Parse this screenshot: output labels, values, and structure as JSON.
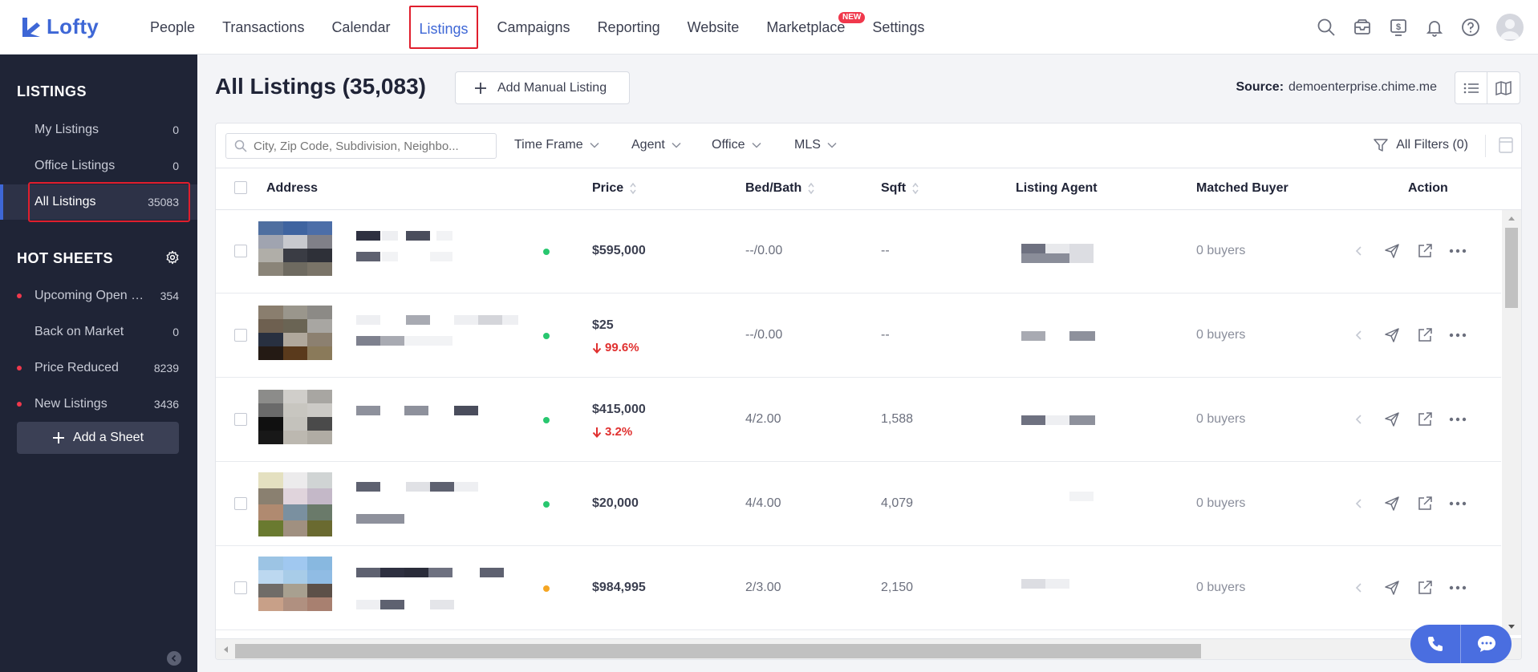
{
  "brand": {
    "name": "Lofty",
    "color": "#3e67d6"
  },
  "nav": {
    "items": [
      "People",
      "Transactions",
      "Calendar",
      "Listings",
      "Campaigns",
      "Reporting",
      "Website",
      "Marketplace",
      "Settings"
    ],
    "active": "Listings",
    "marketplace_badge": "NEW"
  },
  "top_icons": [
    "search-icon",
    "inbox-icon",
    "dollar-icon",
    "bell-icon",
    "help-icon",
    "avatar"
  ],
  "sidebar": {
    "listings_title": "LISTINGS",
    "listings": [
      {
        "label": "My Listings",
        "count": "0"
      },
      {
        "label": "Office Listings",
        "count": "0"
      },
      {
        "label": "All Listings",
        "count": "35083"
      }
    ],
    "hot_sheets_title": "HOT SHEETS",
    "hot_sheets": [
      {
        "label": "Upcoming Open Houses",
        "count": "354",
        "dot": true
      },
      {
        "label": "Back on Market",
        "count": "0",
        "dot": false
      },
      {
        "label": "Price Reduced",
        "count": "8239",
        "dot": true
      },
      {
        "label": "New Listings",
        "count": "3436",
        "dot": true
      }
    ],
    "add_sheet": "Add a Sheet"
  },
  "main": {
    "title": "All Listings (35,083)",
    "add_manual": "Add Manual Listing",
    "source_label": "Source:",
    "source_value": "demoenterprise.chime.me"
  },
  "filters": {
    "search_placeholder": "City, Zip Code, Subdivision, Neighbo...",
    "time_frame": "Time Frame",
    "agent": "Agent",
    "office": "Office",
    "mls": "MLS",
    "all_filters": "All Filters (0)"
  },
  "table": {
    "headers": {
      "address": "Address",
      "price": "Price",
      "bedbath": "Bed/Bath",
      "sqft": "Sqft",
      "agent": "Listing Agent",
      "buyer": "Matched Buyer",
      "action": "Action"
    },
    "rows": [
      {
        "price": "$595,000",
        "change": "",
        "bedbath": "--/0.00",
        "sqft": "--",
        "buyers": "0 buyers",
        "status_color": "#28c76f"
      },
      {
        "price": "$25",
        "change": "99.6%",
        "bedbath": "--/0.00",
        "sqft": "--",
        "buyers": "0 buyers",
        "status_color": "#28c76f"
      },
      {
        "price": "$415,000",
        "change": "3.2%",
        "bedbath": "4/2.00",
        "sqft": "1,588",
        "buyers": "0 buyers",
        "status_color": "#28c76f"
      },
      {
        "price": "$20,000",
        "change": "",
        "bedbath": "4/4.00",
        "sqft": "4,079",
        "buyers": "0 buyers",
        "status_color": "#28c76f"
      },
      {
        "price": "$984,995",
        "change": "",
        "bedbath": "2/3.00",
        "sqft": "2,150",
        "buyers": "0 buyers",
        "status_color": "#f5a623"
      }
    ]
  }
}
